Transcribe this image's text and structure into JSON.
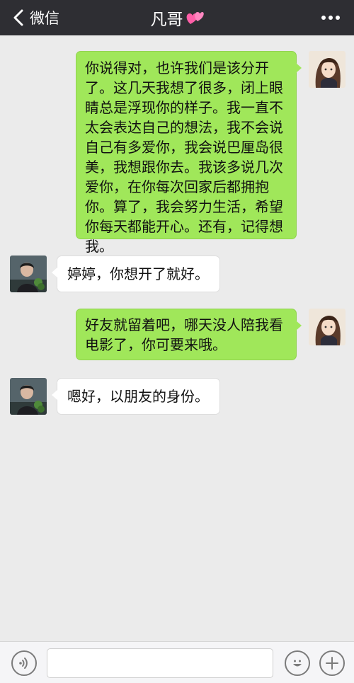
{
  "nav": {
    "back_label": "微信",
    "title": "凡哥",
    "title_emoji": "heart-emoji",
    "more": "more-icon"
  },
  "messages": [
    {
      "side": "out",
      "lines": [
        "你说得对，也许我们是该分开",
        "了。这几天我想了很多，闭上眼",
        "睛总是浮现你的样子。我一直不",
        "太会表达自己的想法，我不会说",
        "自己有多爱你，我会说巴厘岛很",
        "美，我想跟你去。我该多说几次",
        "爱你，在你每次回家后都拥抱",
        "你。算了，我会努力生活，希望",
        "你每天都能开心。还有，记得想",
        "我。"
      ]
    },
    {
      "side": "in",
      "lines": [
        "婷婷，你想开了就好。"
      ]
    },
    {
      "side": "out",
      "lines": [
        "好友就留着吧，哪天没人陪我看",
        "电影了，你可要来哦。"
      ]
    },
    {
      "side": "in",
      "lines": [
        "嗯好，以朋友的身份。"
      ]
    }
  ],
  "input": {
    "voice": "voice-icon",
    "emoji": "emoji-icon",
    "plus": "plus-icon",
    "value": ""
  },
  "colors": {
    "navbar": "#2e2e33",
    "background": "#ebebeb",
    "bubble_out": "#a0e75a",
    "bubble_in": "#ffffff"
  }
}
